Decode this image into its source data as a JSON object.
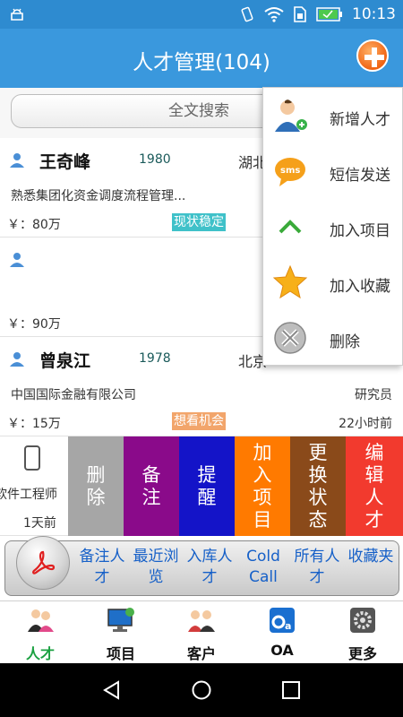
{
  "status_bar": {
    "time": "10:13"
  },
  "header": {
    "title": "人才管理(104)"
  },
  "search": {
    "label": "全文搜索"
  },
  "list": [
    {
      "name": "王奇峰",
      "year": "1980",
      "location": "湖北",
      "description": "熟悉集团化资金调度流程管理...",
      "salary": "￥：80万",
      "tag": "现状稳定",
      "tag_color": "#3fc1c9",
      "role": "",
      "time": ""
    },
    {
      "name": "",
      "year": "",
      "location": "",
      "description": "",
      "salary": "￥：90万",
      "tag": "",
      "tag_color": "",
      "role": "",
      "time": ""
    },
    {
      "name": "曾泉江",
      "year": "1978",
      "location": "北京",
      "description": "中国国际金融有限公司",
      "salary": "￥：15万",
      "tag": "想看机会",
      "tag_color": "#f2a56b",
      "role": "研究员",
      "time": "22小时前"
    }
  ],
  "swipe_row": {
    "partial_role": "软件工程师",
    "partial_time": "1天前",
    "actions": [
      {
        "label": "删除",
        "color": "#a6a6a6"
      },
      {
        "label": "备注",
        "color": "#8a0a8a"
      },
      {
        "label": "提醒",
        "color": "#1414c8"
      },
      {
        "label": "加入项目",
        "color": "#ff7a00"
      },
      {
        "label": "更换状态",
        "color": "#8a4a1a"
      },
      {
        "label": "编辑人才",
        "color": "#f23a2e"
      }
    ]
  },
  "quick_bar": {
    "items": [
      {
        "label": "备注人才"
      },
      {
        "label": "最近浏览"
      },
      {
        "label": "入库人才"
      },
      {
        "label": "Cold Call"
      },
      {
        "label": "所有人才"
      },
      {
        "label": "收藏夹"
      }
    ]
  },
  "bottom_nav": {
    "items": [
      {
        "label": "人才",
        "icon": "people-icon",
        "active": true
      },
      {
        "label": "项目",
        "icon": "monitor-icon",
        "active": false
      },
      {
        "label": "客户",
        "icon": "clients-icon",
        "active": false
      },
      {
        "label": "OA",
        "icon": "oa-icon",
        "active": false
      },
      {
        "label": "更多",
        "icon": "gear-icon",
        "active": false
      }
    ]
  },
  "popup_menu": {
    "items": [
      {
        "label": "新增人才",
        "icon": "add-person-icon"
      },
      {
        "label": "短信发送",
        "icon": "sms-icon"
      },
      {
        "label": "加入项目",
        "icon": "chevron-up-icon"
      },
      {
        "label": "加入收藏",
        "icon": "star-icon"
      },
      {
        "label": "删除",
        "icon": "delete-icon"
      }
    ]
  },
  "colors": {
    "header": "#3a98dd",
    "status_bar": "#2e8bd0",
    "link_blue": "#1660c8",
    "active_nav": "#1aa040"
  }
}
